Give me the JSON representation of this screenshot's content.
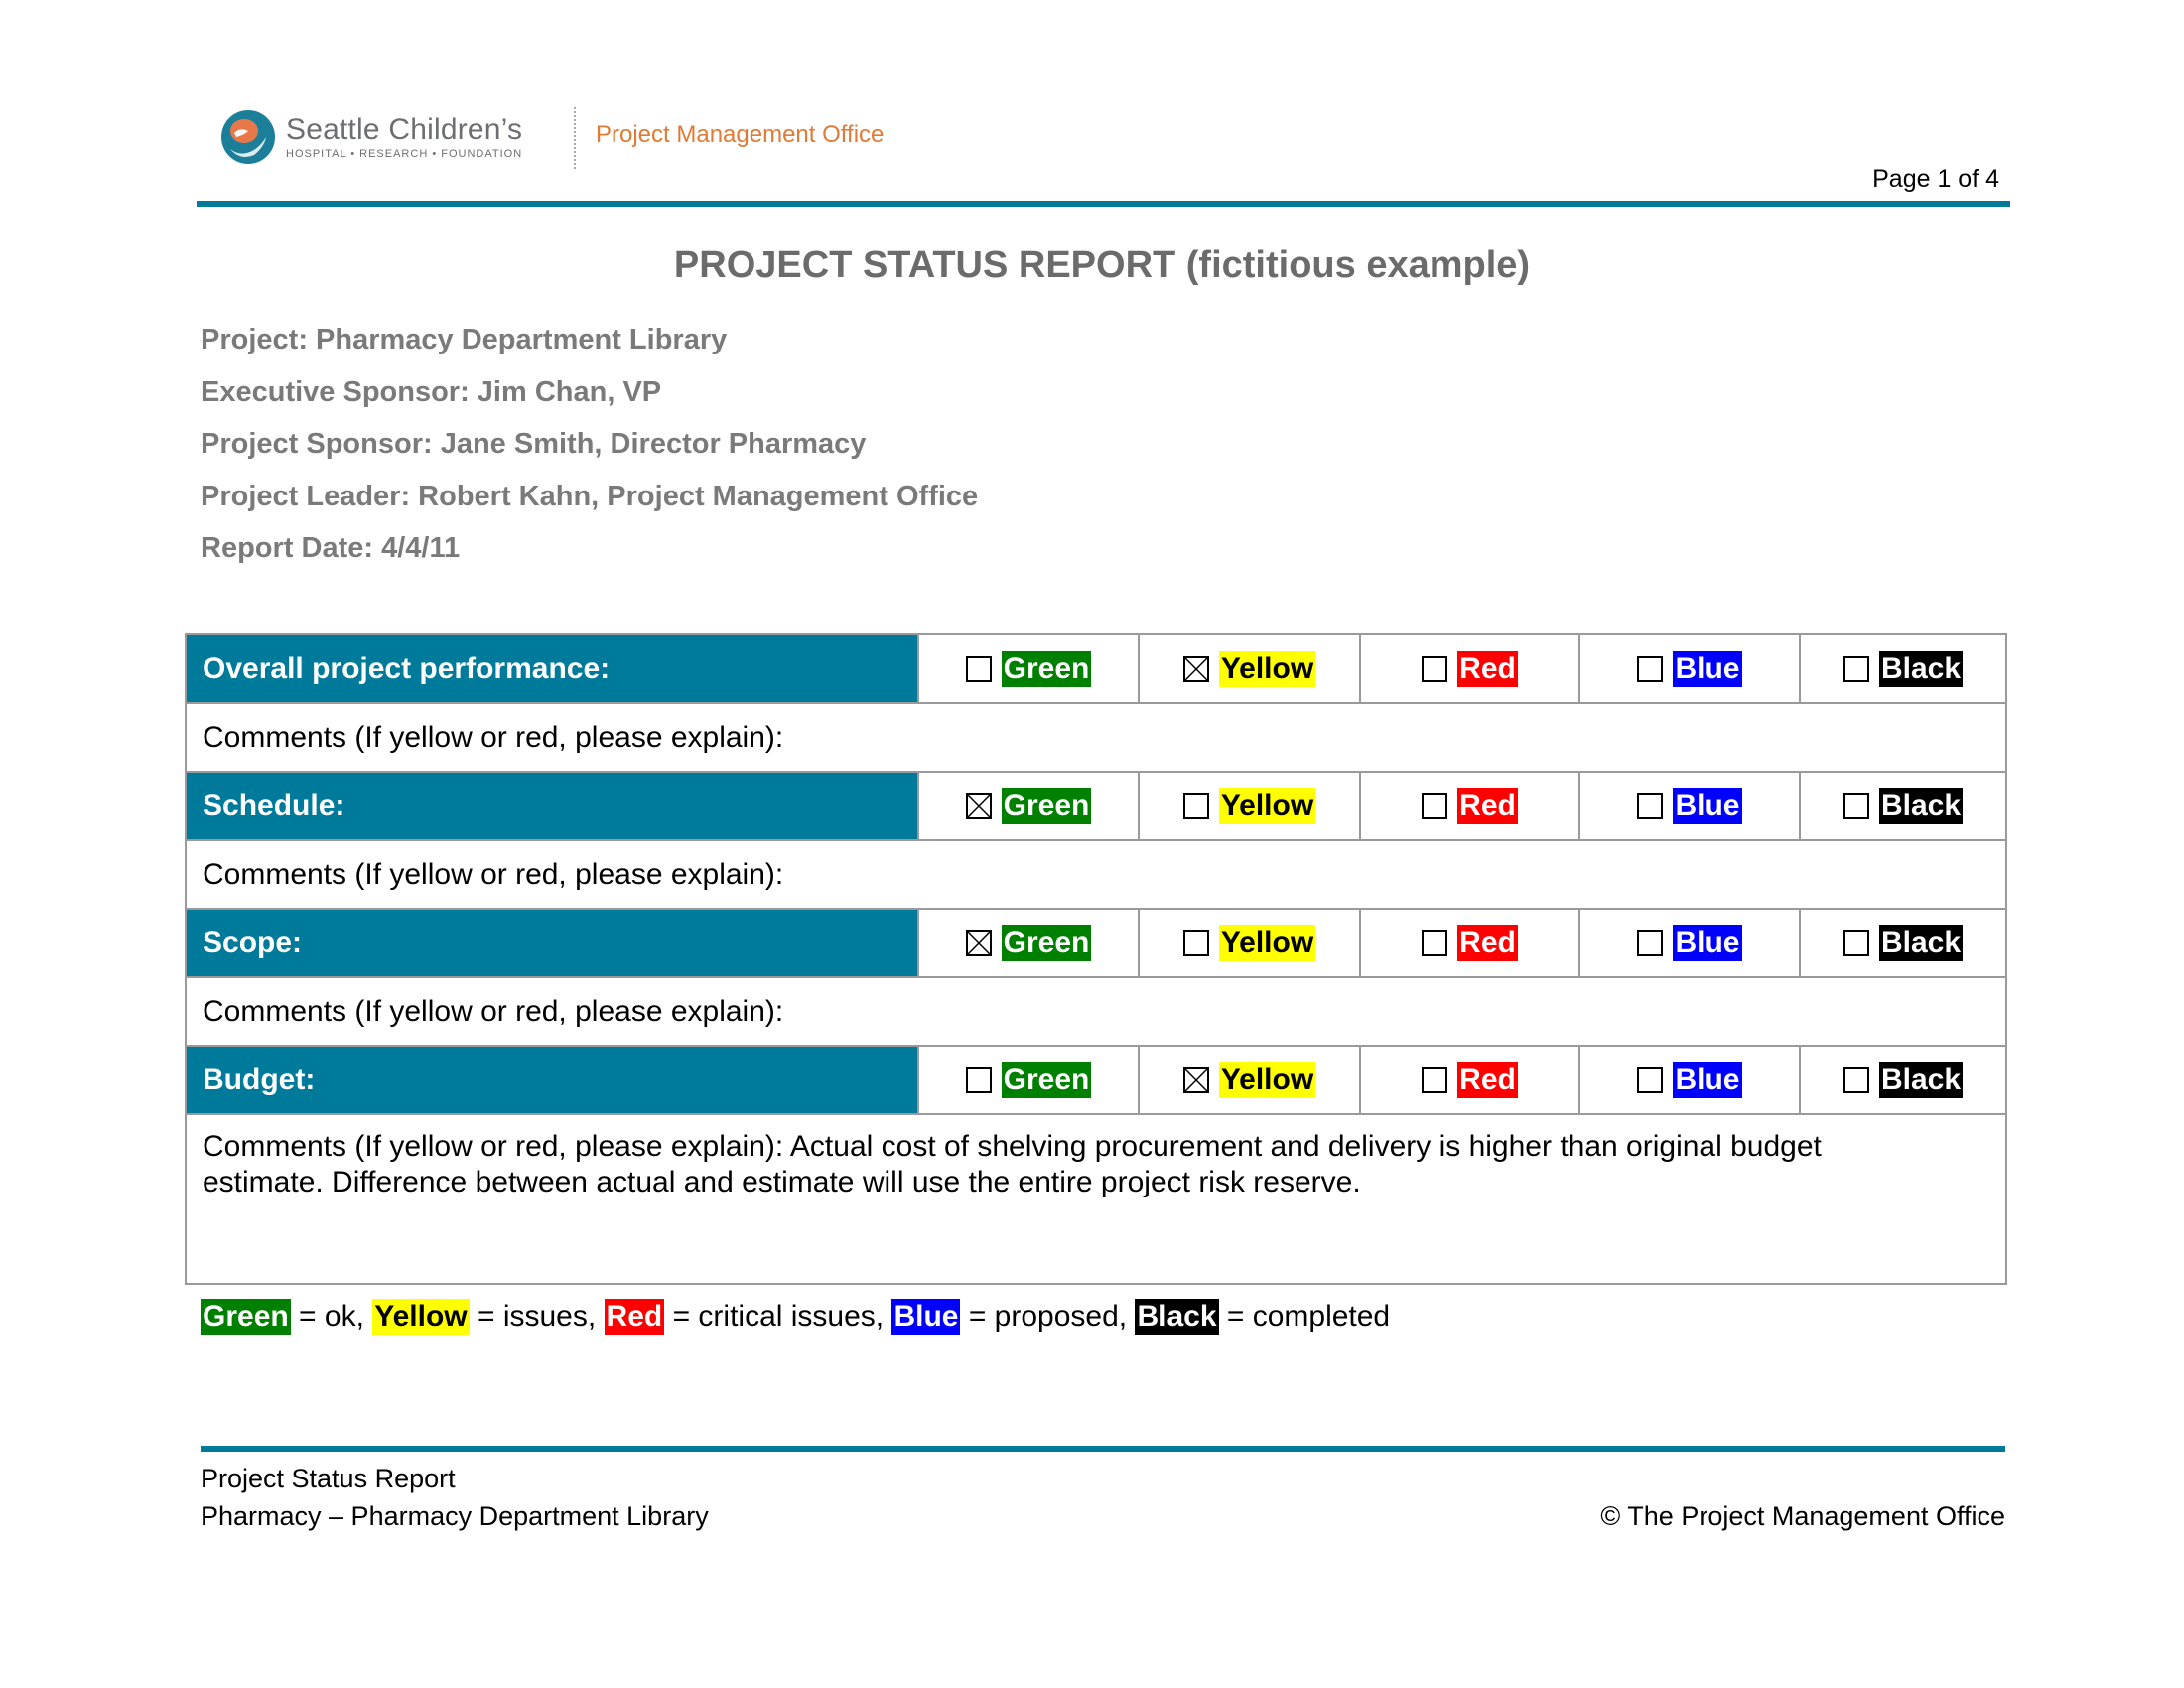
{
  "header": {
    "logo_name": "Seattle Children’s",
    "logo_subtitle": "HOSPITAL • RESEARCH • FOUNDATION",
    "department": "Project Management Office",
    "page_indicator": "Page 1 of 4"
  },
  "title": "PROJECT STATUS REPORT (fictitious example)",
  "meta": {
    "project": "Project: Pharmacy Department Library",
    "executive_sponsor": "Executive Sponsor: Jim Chan, VP",
    "project_sponsor": "Project Sponsor:  Jane Smith, Director Pharmacy",
    "project_leader": "Project Leader: Robert Kahn, Project Management Office",
    "report_date": "Report Date: 4/4/11"
  },
  "status_options": [
    "Green",
    "Yellow",
    "Red",
    "Blue",
    "Black"
  ],
  "colors": {
    "Green": "#008000",
    "Yellow": "#ffff00",
    "Red": "#ff0000",
    "Blue": "#0000ff",
    "Black": "#000000",
    "header_band": "#007a9a",
    "accent_orange": "#e07a35"
  },
  "categories": [
    {
      "label": "Overall project performance:",
      "selected": "Yellow",
      "comment": "Comments (If yellow or red, please explain):"
    },
    {
      "label": "Schedule:",
      "selected": "Green",
      "comment": "Comments (If yellow or red, please explain):"
    },
    {
      "label": "Scope:",
      "selected": "Green",
      "comment": "Comments (If yellow or red, please explain):"
    },
    {
      "label": "Budget:",
      "selected": "Yellow",
      "comment": "Comments (If yellow or red, please explain):  Actual cost of shelving procurement and delivery is higher than original budget estimate.  Difference between actual and estimate will use the entire project risk reserve."
    }
  ],
  "legend": [
    {
      "color": "Green",
      "meaning": " = ok, "
    },
    {
      "color": "Yellow",
      "meaning": " = issues, "
    },
    {
      "color": "Red",
      "meaning": " = critical issues, "
    },
    {
      "color": "Blue",
      "meaning": " = proposed, "
    },
    {
      "color": "Black",
      "meaning": " = completed"
    }
  ],
  "footer": {
    "line1": "Project Status Report",
    "line2": "Pharmacy – Pharmacy Department Library",
    "copyright": "© The Project Management Office"
  }
}
